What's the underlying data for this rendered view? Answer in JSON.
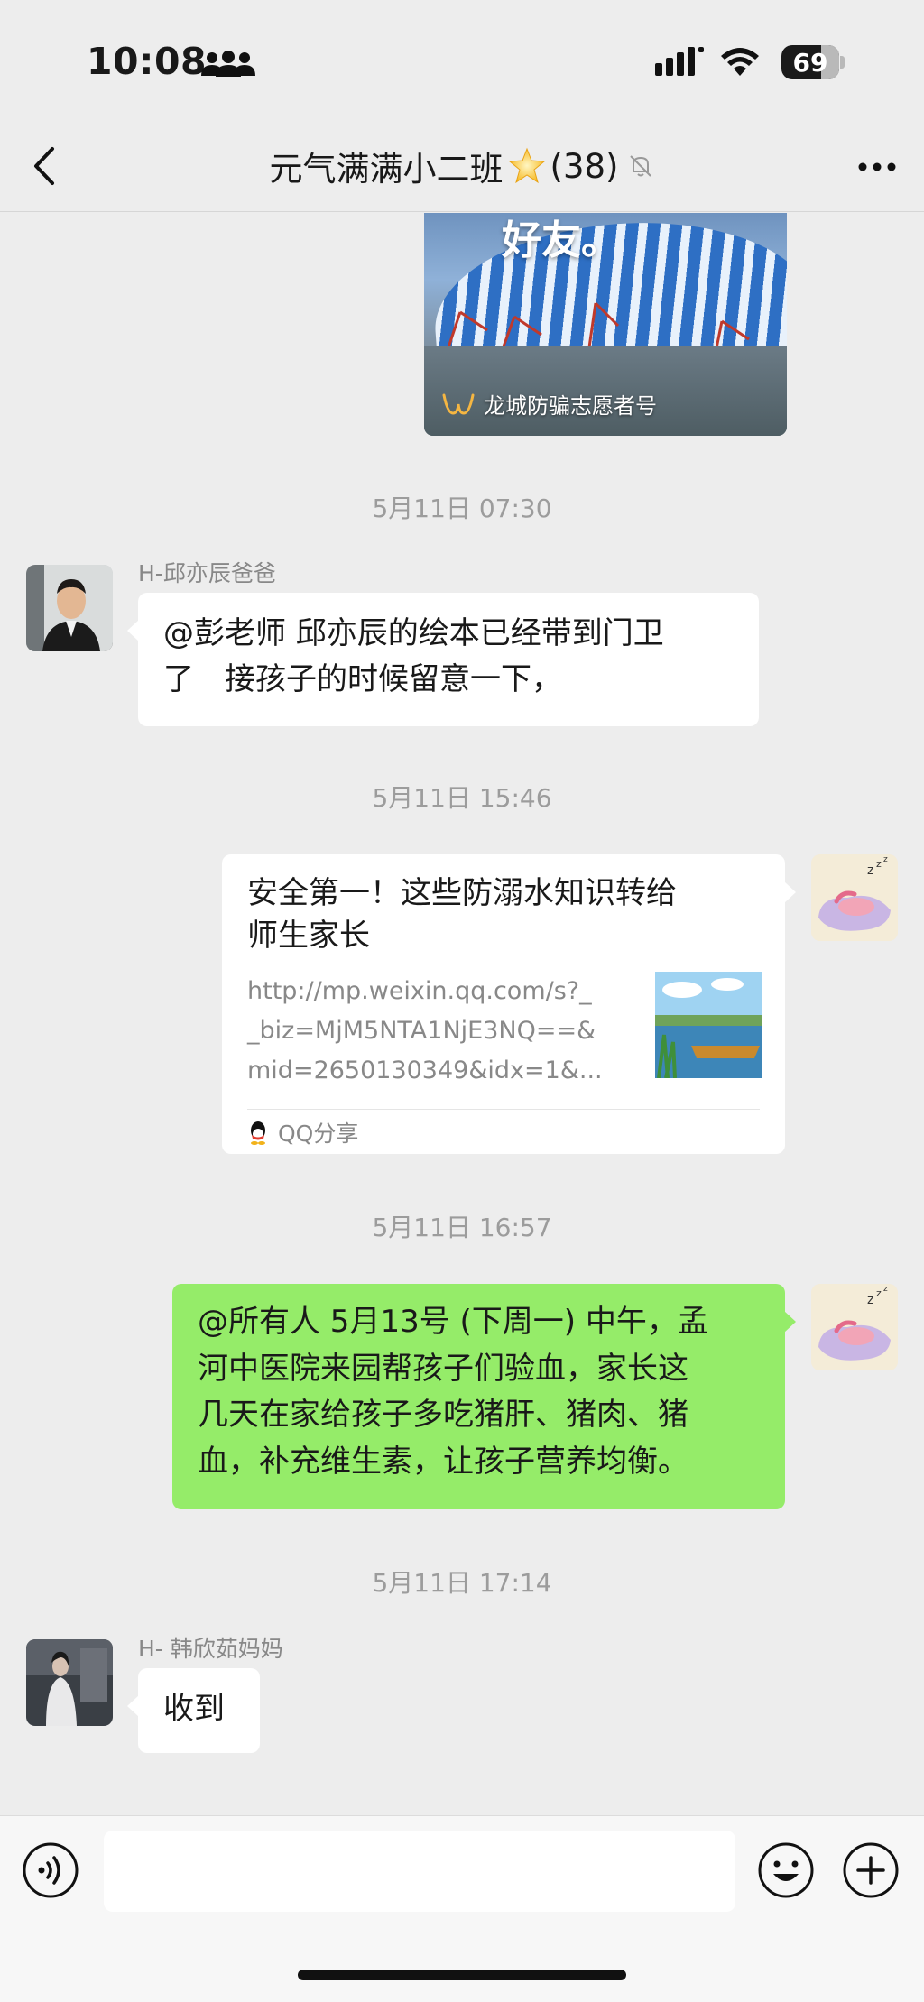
{
  "status_bar": {
    "time": "10:08",
    "battery": "69"
  },
  "header": {
    "title": "元气满满小二班",
    "member_count": "(38)"
  },
  "shared_image": {
    "overlay_text": "好友。",
    "source": "龙城防骗志愿者号"
  },
  "messages": [
    {
      "timestamp": "5月11日 07:30",
      "sender": "H-邱亦辰爸爸",
      "lines": [
        "@彭老师 邱亦辰的绘本已经带到门卫",
        "了　接孩子的时候留意一下，"
      ]
    },
    {
      "timestamp": "5月11日 15:46",
      "link": {
        "title_lines": [
          "安全第一！这些防溺水知识转给",
          "师生家长"
        ],
        "url_lines": [
          "http://mp.weixin.qq.com/s?_",
          "_biz=MjM5NTA1NjE3NQ==&",
          "mid=2650130349&idx=1&..."
        ],
        "source": "QQ分享"
      }
    },
    {
      "timestamp": "5月11日 16:57",
      "lines": [
        "@所有人 5月13号 (下周一) 中午，孟",
        "河中医院来园帮孩子们验血，家长这",
        "几天在家给孩子多吃猪肝、猪肉、猪",
        "血，补充维生素，让孩子营养均衡。"
      ]
    },
    {
      "timestamp": "5月11日 17:14",
      "sender": "H- 韩欣茹妈妈",
      "lines": [
        "收到"
      ]
    }
  ],
  "input": {
    "placeholder": ""
  },
  "icons": {
    "back": "chevron-left-icon",
    "more": "ellipsis-icon",
    "star": "star-icon",
    "muted": "bell-off-icon",
    "voice": "voice-icon",
    "emoji": "emoji-icon",
    "plus": "plus-icon"
  },
  "colors": {
    "background": "#ededed",
    "sent_bubble": "#95ec69",
    "received_bubble": "#ffffff",
    "meta_text": "#9c9c9c"
  }
}
